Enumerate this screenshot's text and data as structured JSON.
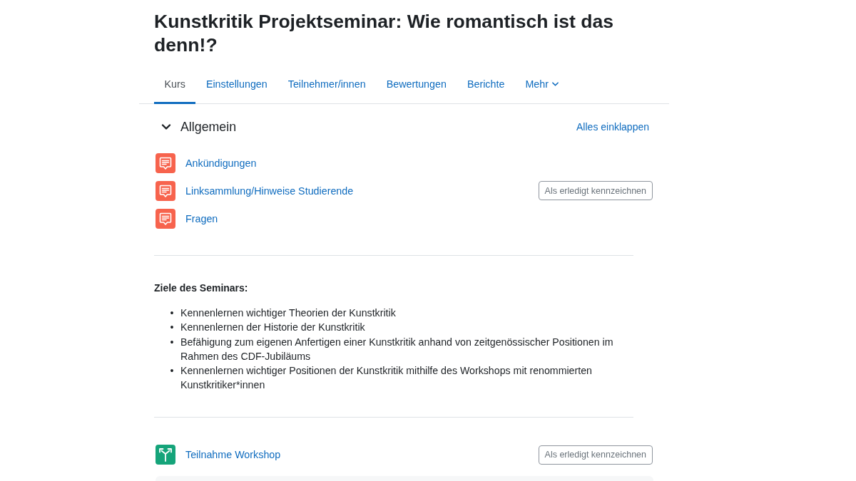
{
  "page_title": "Kunstkritik Projektseminar: Wie romantisch ist das denn!?",
  "tabs": [
    {
      "label": "Kurs",
      "selected": true,
      "has_menu": false
    },
    {
      "label": "Einstellungen",
      "selected": false,
      "has_menu": false
    },
    {
      "label": "Teilnehmer/innen",
      "selected": false,
      "has_menu": false
    },
    {
      "label": "Bewertungen",
      "selected": false,
      "has_menu": false
    },
    {
      "label": "Berichte",
      "selected": false,
      "has_menu": false
    },
    {
      "label": "Mehr",
      "selected": false,
      "has_menu": true
    }
  ],
  "section": {
    "title": "Allgemein",
    "expanded": true,
    "collapse_all_link": "Alles einklappen"
  },
  "activities": [
    {
      "kind": "forum",
      "name": "Ankündigungen"
    },
    {
      "kind": "forum",
      "name": "Linksammlung/Hinweise Studierende",
      "completion_button": "Als erledigt kennzeichnen"
    },
    {
      "kind": "forum",
      "name": "Fragen"
    }
  ],
  "summary": {
    "heading": "Ziele des Seminars:",
    "items": [
      {
        "bullet": "•",
        "text": "Kennenlernen wichtiger Theorien der Kunstkritik"
      },
      {
        "bullet": "•",
        "text": "Kennenlernen der Historie der Kunstkritik"
      },
      {
        "bullet": "•",
        "text": "Befähigung zum eigenen Anfertigen einer Kunstkritik anhand von zeitgenössischer Positionen im Rahmen des CDF-Jubiläums"
      },
      {
        "bullet": "•",
        "text": "Kennenlernen wichtiger Positionen der Kunstkritik mithilfe des Workshops mit renommierten Kunstkritiker*innen"
      }
    ]
  },
  "activities_2": [
    {
      "kind": "choice",
      "name": "Teilnahme Workshop",
      "completion_button": "Als erledigt kennzeichnen"
    }
  ]
}
